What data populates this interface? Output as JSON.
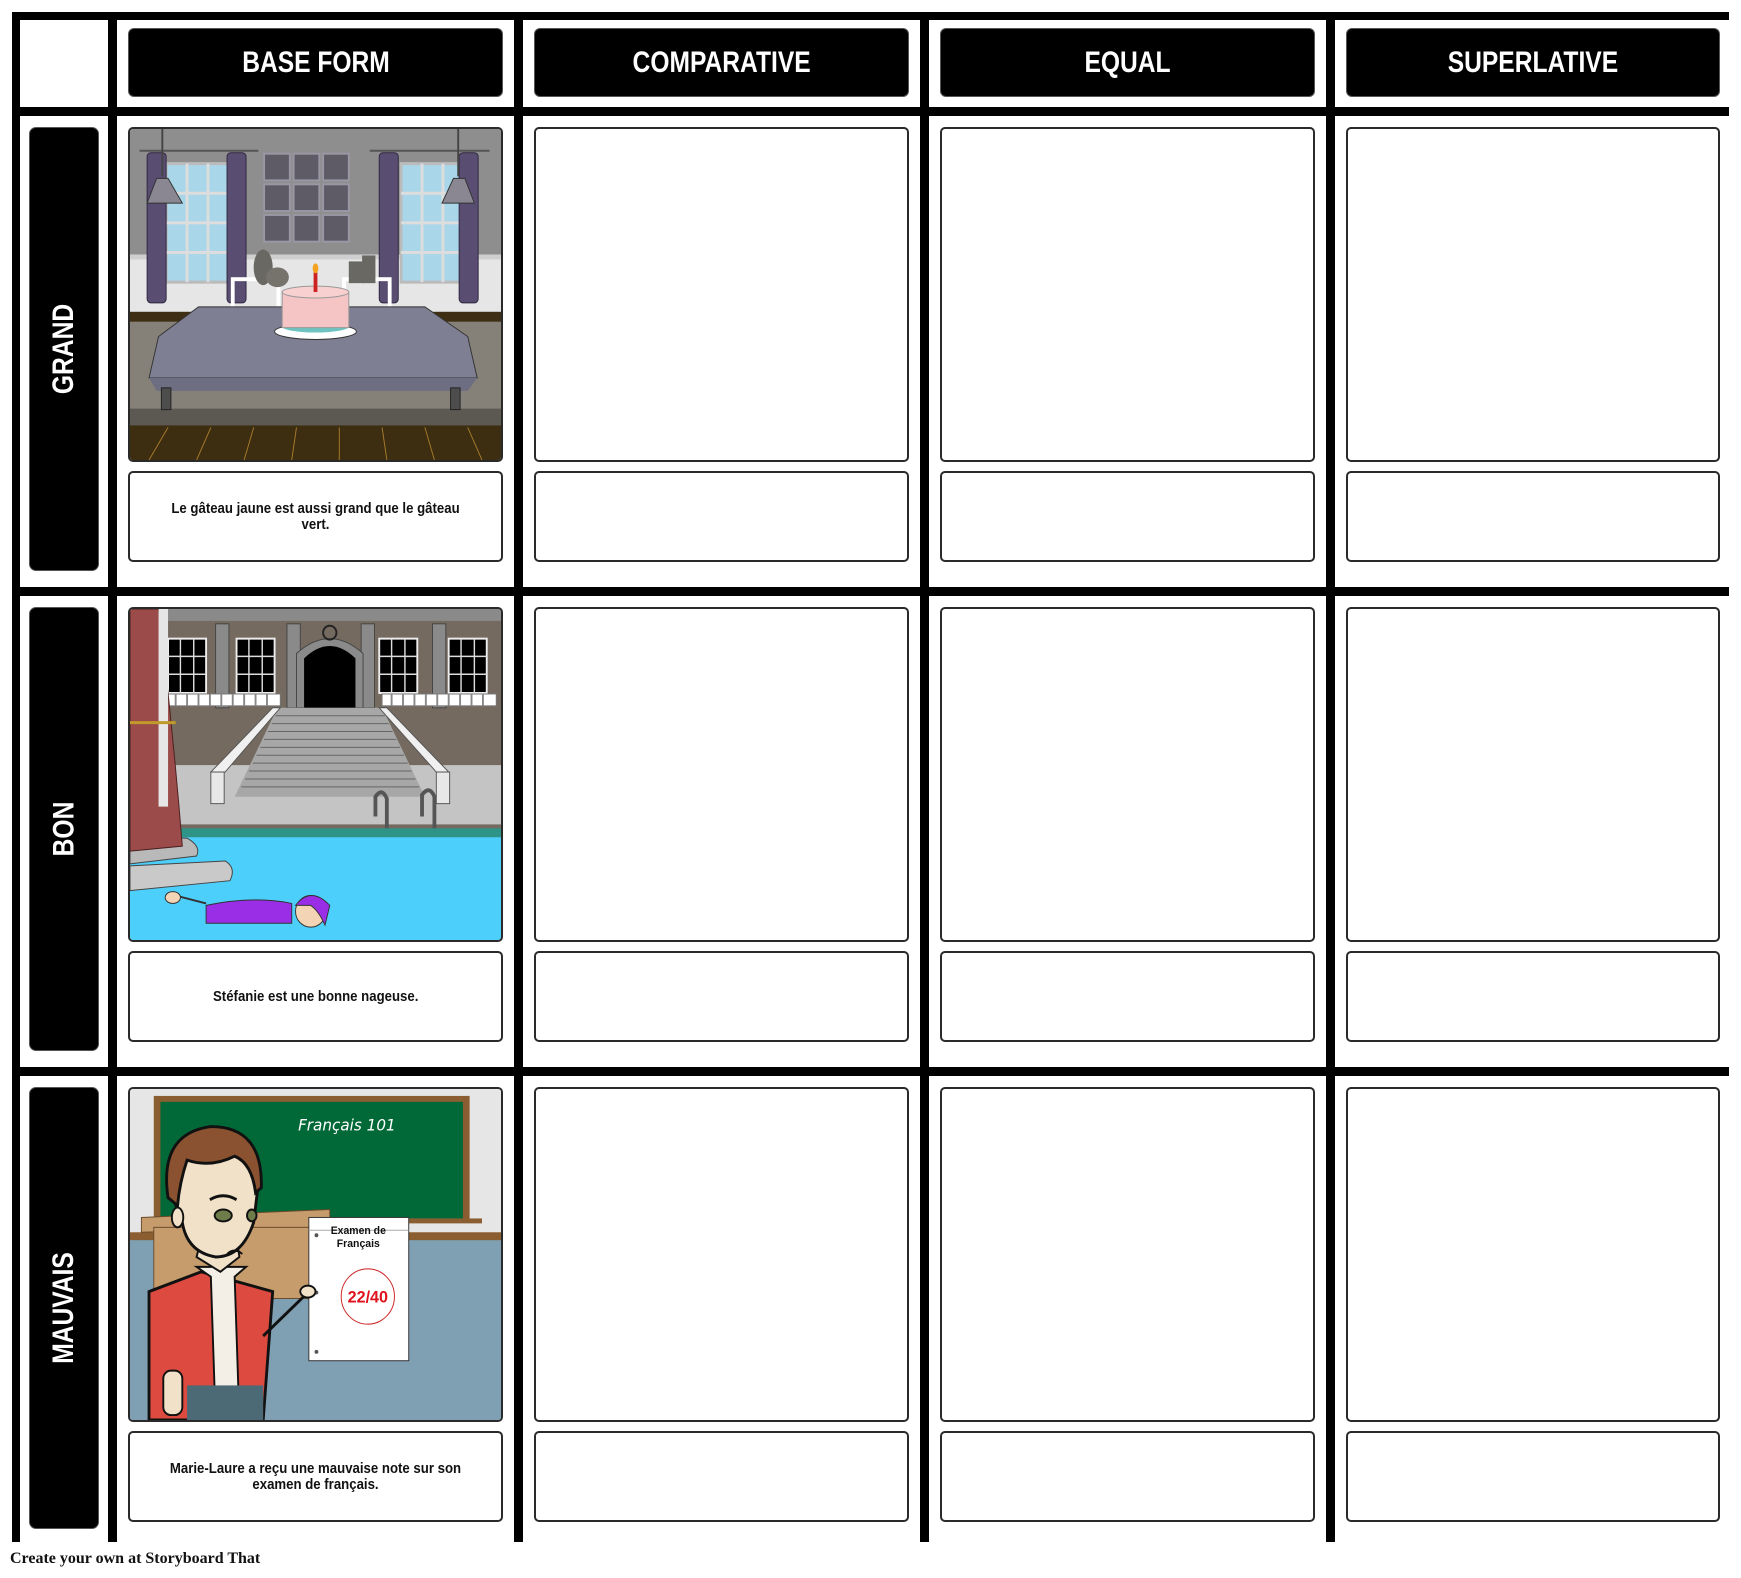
{
  "storyboard": {
    "column_headers": [
      "BASE FORM",
      "COMPARATIVE",
      "EQUAL",
      "SUPERLATIVE"
    ],
    "rows": [
      {
        "label": "GRAND",
        "cells": [
          {
            "image": "dining-room-cake-scene",
            "caption": "Le gâteau jaune est aussi grand que le gâteau vert."
          },
          {
            "image": "",
            "caption": ""
          },
          {
            "image": "",
            "caption": ""
          },
          {
            "image": "",
            "caption": ""
          }
        ]
      },
      {
        "label": "BON",
        "cells": [
          {
            "image": "swimming-pool-palace-scene",
            "caption": "Stéfanie est une bonne nageuse."
          },
          {
            "image": "",
            "caption": ""
          },
          {
            "image": "",
            "caption": ""
          },
          {
            "image": "",
            "caption": ""
          }
        ]
      },
      {
        "label": "MAUVAIS",
        "cells": [
          {
            "image": "classroom-exam-scene",
            "caption": "Marie-Laure a reçu une mauvaise note sur son examen de français."
          },
          {
            "image": "",
            "caption": ""
          },
          {
            "image": "",
            "caption": ""
          },
          {
            "image": "",
            "caption": ""
          }
        ]
      }
    ],
    "scene_text": {
      "chalkboard": "Français 101",
      "exam_title_line1": "Examen de",
      "exam_title_line2": "Français",
      "exam_score": "22/40"
    },
    "colors": {
      "grid": "#000000",
      "pill": "#000000",
      "pill_text": "#ffffff",
      "score_red": "#e0141e"
    }
  },
  "footer": {
    "credit": "Create your own at Storyboard That"
  }
}
